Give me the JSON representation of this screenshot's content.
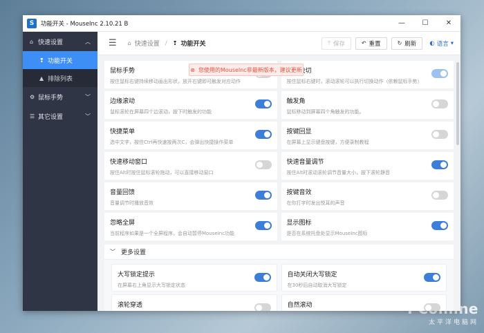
{
  "window": {
    "app_icon": "S",
    "title": "功能开关 - MouseInc 2.10.21 B",
    "ctrl_min": "—",
    "ctrl_max": "☐",
    "ctrl_close": "✕"
  },
  "sidebar": {
    "groups": [
      {
        "icon": "home-icon",
        "glyph": "⌂",
        "label": "快速设置",
        "chevron": "︿"
      },
      {
        "icon": "gear-icon",
        "glyph": "⚙",
        "label": "鼠标手势",
        "chevron": "﹀"
      },
      {
        "icon": "list-icon",
        "glyph": "☰",
        "label": "其它设置",
        "chevron": "﹀"
      }
    ],
    "subs": [
      {
        "icon": "switch-icon",
        "glyph": "❢",
        "label": "功能开关",
        "active": true
      },
      {
        "icon": "warning-icon",
        "glyph": "▲",
        "label": "排除列表",
        "active": false
      }
    ]
  },
  "header": {
    "menu_glyph": "☰",
    "crumb_home": "快速设置",
    "crumb_sep": "/",
    "crumb_current": "功能开关",
    "save": "保存",
    "reset": "重置",
    "refresh": "刷新",
    "language": "语言"
  },
  "notice": "您使用的MouseInc非最新版本，建议更新",
  "cards": [
    {
      "title": "鼠标手势",
      "desc": "按住鼠标右键持续移动画出形状，放开右键即可触发对应动作",
      "state": "off"
    },
    {
      "title": "滚轮快切",
      "desc": "按住鼠标右键时，滚动滚轮可以执行切换动作（依赖鼠标手势）",
      "state": "on-light"
    },
    {
      "title": "边缘滚动",
      "desc": "鼠标滚轮在屏幕四个边滚动，按下时触发的功能",
      "state": "on"
    },
    {
      "title": "触发角",
      "desc": "鼠标移动到屏幕四个角触发的功能。",
      "state": "off"
    },
    {
      "title": "快捷菜单",
      "desc": "选中文字，按住Ctrl再快速按两次C，会弹出快捷操作菜单",
      "state": "on"
    },
    {
      "title": "按键回显",
      "desc": "在屏幕上显示键盘按键，方便录制教程",
      "state": "off"
    },
    {
      "title": "快速移动窗口",
      "desc": "按住Alt时按住鼠标滚轮拖动，可以直接移动窗口",
      "state": "off"
    },
    {
      "title": "快速音量调节",
      "desc": "按住Alt时滚动滚轮调节音量大小，按下滚轮静音",
      "state": "on"
    },
    {
      "title": "音量回馈",
      "desc": "音量调节时播放音效",
      "state": "on"
    },
    {
      "title": "按键音效",
      "desc": "在你打字时发出悦耳的声音",
      "state": "off"
    },
    {
      "title": "忽略全屏",
      "desc": "当前程序如果是一个全屏程序，会自动暂停MouseInc功能",
      "state": "on"
    },
    {
      "title": "显示图标",
      "desc": "是否在系统托盘处显示MouseInc图标",
      "state": "on"
    }
  ],
  "more": {
    "chevron": "﹀",
    "title": "更多设置",
    "cards": [
      {
        "title": "大写锁定提示",
        "desc": "在屏幕右上角显示大写锁定状态",
        "state": "on"
      },
      {
        "title": "自动关闭大写锁定",
        "desc": "在30秒后自动取消大写锁定",
        "state": "on"
      },
      {
        "title": "滚轮穿透",
        "desc": "",
        "state": "off"
      },
      {
        "title": "自然滚动",
        "desc": "",
        "state": "off"
      }
    ]
  },
  "watermark": {
    "big": "PConline",
    "small": "太平洋电脑网"
  }
}
